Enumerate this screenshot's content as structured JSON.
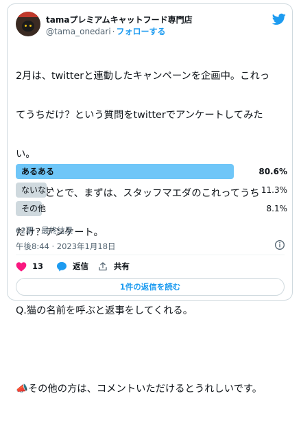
{
  "author": {
    "name": "tamaプレミアムキャットフード専門店",
    "handle": "@tama_onedari",
    "separator": "·",
    "follow_label": "フォローする"
  },
  "tweet": {
    "lines": [
      "2月は、twitterと連動したキャンペーンを企画中。これっ",
      "てうちだけ？という質問をtwitterでアンケートしてみた",
      "い。",
      "ということで、まずは、スタッフマエダのこれってうち",
      "だけ？アンケート。",
      "",
      "Q.猫の名前を呼ぶと返事をしてくれる。",
      "",
      "📣その他の方は、コメントいただけるとうれしいです。"
    ]
  },
  "poll": {
    "options": [
      {
        "label": "あるある",
        "percent_text": "80.6%",
        "percent": 80.6,
        "winner": true
      },
      {
        "label": "ないない",
        "percent_text": "11.3%",
        "percent": 11.3,
        "winner": false
      },
      {
        "label": "その他",
        "percent_text": "8.1%",
        "percent": 8.1,
        "winner": false
      }
    ],
    "summary": "62票 · 最終結果"
  },
  "timestamp": "午後8:44 · 2023年1月18日",
  "actions": {
    "likes": "13",
    "reply_label": "返信",
    "share_label": "共有"
  },
  "read_replies_label": "1件の返信を読む",
  "colors": {
    "accent": "#1d9bf0",
    "winner_bar": "#6fc6f8",
    "loser_bar": "#cfd9de",
    "like": "#f91880"
  }
}
